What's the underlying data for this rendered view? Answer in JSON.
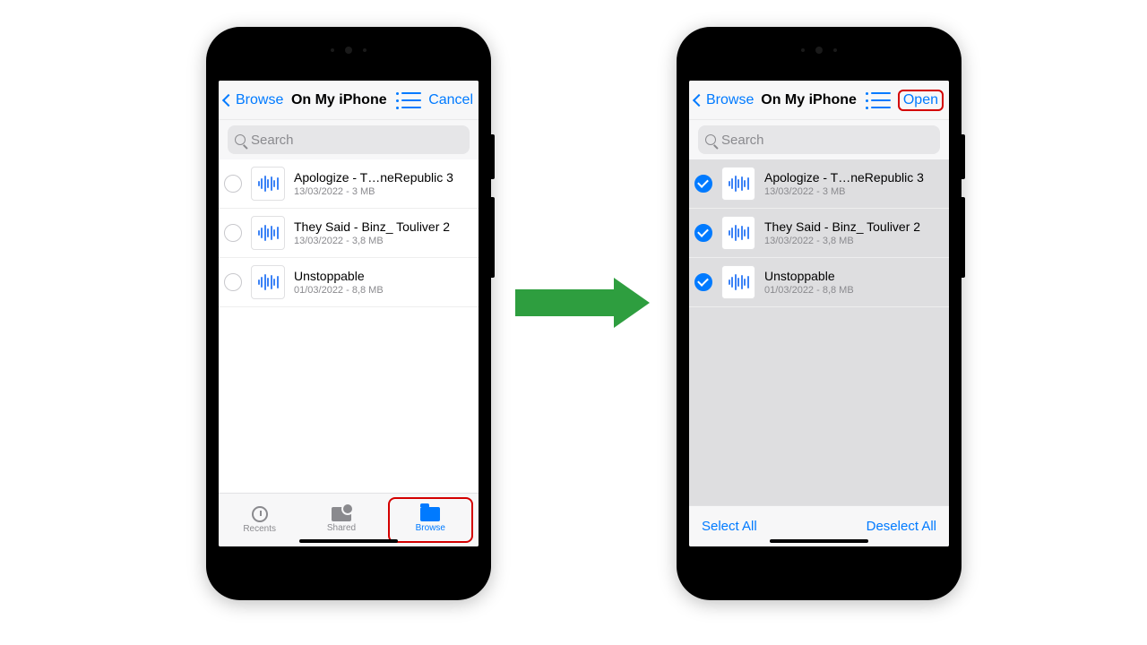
{
  "left": {
    "nav": {
      "back": "Browse",
      "title": "On My iPhone",
      "action": "Cancel"
    },
    "search": {
      "placeholder": "Search"
    },
    "files": [
      {
        "name": "Apologize - T…neRepublic 3",
        "sub": "13/03/2022 - 3 MB"
      },
      {
        "name": "They Said - Binz_ Touliver 2",
        "sub": "13/03/2022 - 3,8 MB"
      },
      {
        "name": "Unstoppable",
        "sub": "01/03/2022 - 8,8 MB"
      }
    ],
    "tabs": {
      "recents": "Recents",
      "shared": "Shared",
      "browse": "Browse"
    }
  },
  "right": {
    "nav": {
      "back": "Browse",
      "title": "On My iPhone",
      "action": "Open"
    },
    "search": {
      "placeholder": "Search"
    },
    "files": [
      {
        "name": "Apologize - T…neRepublic 3",
        "sub": "13/03/2022 - 3 MB"
      },
      {
        "name": "They Said - Binz_ Touliver 2",
        "sub": "13/03/2022 - 3,8 MB"
      },
      {
        "name": "Unstoppable",
        "sub": "01/03/2022 - 8,8 MB"
      }
    ],
    "selbar": {
      "selectAll": "Select All",
      "deselectAll": "Deselect All"
    }
  }
}
